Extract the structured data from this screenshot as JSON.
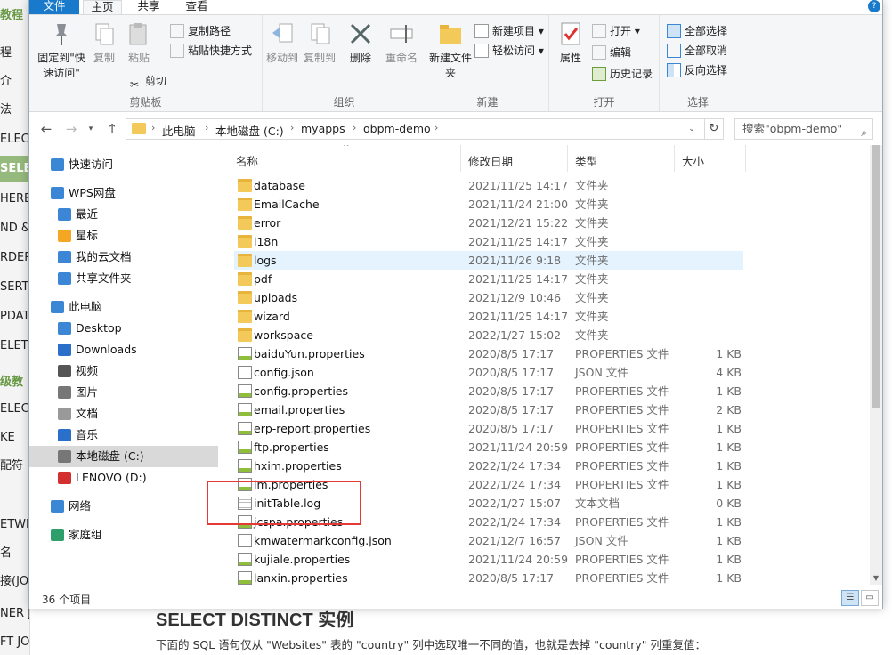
{
  "background_page": {
    "sidebar_items": [
      "教程",
      "程",
      "介",
      "法",
      "ELECT",
      "SELECT",
      "HERE",
      "ND &",
      "RDER",
      "SERT",
      "PDATE",
      "ELETE",
      "级教",
      "ELEC",
      "KE",
      "配符",
      "",
      "ETWE",
      "名",
      "接(JO",
      "NER JOIN",
      "FT JOIN"
    ],
    "heading": "SELECT DISTINCT 实例",
    "text": "下面的 SQL 语句仅从 \"Websites\" 表的 \"country\" 列中选取唯一不同的值，也就是去掉 \"country\" 列重复值："
  },
  "tabs": {
    "file": "文件",
    "home": "主页",
    "share": "共享",
    "view": "查看"
  },
  "ribbon": {
    "clipboard": {
      "pin_label": "固定到\"快速访问\"",
      "copy_label": "复制",
      "paste_label": "粘贴",
      "copy_path_label": "复制路径",
      "paste_shortcut_label": "粘贴快捷方式",
      "cut_label": "剪切",
      "group_label": "剪贴板"
    },
    "organize": {
      "move_to_label": "移动到",
      "copy_to_label": "复制到",
      "delete_label": "删除",
      "rename_label": "重命名",
      "group_label": "组织"
    },
    "new": {
      "new_folder_label": "新建文件夹",
      "new_item_label": "新建项目",
      "easy_access_label": "轻松访问",
      "group_label": "新建"
    },
    "open": {
      "properties_label": "属性",
      "open_label": "打开",
      "edit_label": "编辑",
      "history_label": "历史记录",
      "group_label": "打开"
    },
    "select": {
      "select_all_label": "全部选择",
      "select_none_label": "全部取消",
      "invert_label": "反向选择",
      "group_label": "选择"
    }
  },
  "address": {
    "crumbs": [
      "此电脑",
      "本地磁盘 (C:)",
      "myapps",
      "obpm-demo"
    ],
    "search_placeholder": "搜索\"obpm-demo\""
  },
  "nav": [
    {
      "label": "快速访问",
      "icon": "star-icon",
      "color": "#3b87d6"
    },
    {
      "label": "WPS网盘",
      "icon": "cloud-icon",
      "color": "#3b87d6"
    },
    {
      "label": "最近",
      "icon": "clock-icon",
      "color": "#3b87d6"
    },
    {
      "label": "星标",
      "icon": "star-icon",
      "color": "#f5a623"
    },
    {
      "label": "我的云文档",
      "icon": "cloud-icon",
      "color": "#3b87d6"
    },
    {
      "label": "共享文件夹",
      "icon": "share-icon",
      "color": "#3b87d6"
    },
    {
      "label": "此电脑",
      "icon": "computer-icon",
      "color": "#3b87d6"
    },
    {
      "label": "Desktop",
      "icon": "desktop-icon",
      "color": "#3b87d6"
    },
    {
      "label": "Downloads",
      "icon": "download-icon",
      "color": "#2a6fc9"
    },
    {
      "label": "视频",
      "icon": "video-icon",
      "color": "#555555"
    },
    {
      "label": "图片",
      "icon": "picture-icon",
      "color": "#777777"
    },
    {
      "label": "文档",
      "icon": "document-icon",
      "color": "#999999"
    },
    {
      "label": "音乐",
      "icon": "music-icon",
      "color": "#2a6fc9"
    },
    {
      "label": "本地磁盘 (C:)",
      "icon": "drive-icon",
      "color": "#777777"
    },
    {
      "label": "LENOVO (D:)",
      "icon": "drive-icon",
      "color": "#d32f2f"
    },
    {
      "label": "网络",
      "icon": "network-icon",
      "color": "#3b87d6"
    },
    {
      "label": "家庭组",
      "icon": "homegroup-icon",
      "color": "#2e9e6a"
    }
  ],
  "columns": {
    "name": "名称",
    "date": "修改日期",
    "type": "类型",
    "size": "大小"
  },
  "files": [
    {
      "name": "database",
      "date": "2021/11/25 14:17",
      "type": "文件夹",
      "size": "",
      "icon": "folder-icon"
    },
    {
      "name": "EmailCache",
      "date": "2021/11/24 21:00",
      "type": "文件夹",
      "size": "",
      "icon": "folder-icon"
    },
    {
      "name": "error",
      "date": "2021/12/21 15:22",
      "type": "文件夹",
      "size": "",
      "icon": "folder-icon"
    },
    {
      "name": "i18n",
      "date": "2021/11/25 14:17",
      "type": "文件夹",
      "size": "",
      "icon": "folder-icon"
    },
    {
      "name": "logs",
      "date": "2021/11/26 9:18",
      "type": "文件夹",
      "size": "",
      "icon": "folder-icon"
    },
    {
      "name": "pdf",
      "date": "2021/11/25 14:17",
      "type": "文件夹",
      "size": "",
      "icon": "folder-icon"
    },
    {
      "name": "uploads",
      "date": "2021/12/9 10:46",
      "type": "文件夹",
      "size": "",
      "icon": "folder-icon"
    },
    {
      "name": "wizard",
      "date": "2021/11/25 14:17",
      "type": "文件夹",
      "size": "",
      "icon": "folder-icon"
    },
    {
      "name": "workspace",
      "date": "2022/1/27 15:02",
      "type": "文件夹",
      "size": "",
      "icon": "folder-icon"
    },
    {
      "name": "baiduYun.properties",
      "date": "2020/8/5 17:17",
      "type": "PROPERTIES 文件",
      "size": "1 KB",
      "icon": "properties-file-icon"
    },
    {
      "name": "config.json",
      "date": "2020/8/5 17:17",
      "type": "JSON 文件",
      "size": "4 KB",
      "icon": "json-file-icon"
    },
    {
      "name": "config.properties",
      "date": "2020/8/5 17:17",
      "type": "PROPERTIES 文件",
      "size": "1 KB",
      "icon": "properties-file-icon"
    },
    {
      "name": "email.properties",
      "date": "2020/8/5 17:17",
      "type": "PROPERTIES 文件",
      "size": "2 KB",
      "icon": "properties-file-icon"
    },
    {
      "name": "erp-report.properties",
      "date": "2020/8/5 17:17",
      "type": "PROPERTIES 文件",
      "size": "1 KB",
      "icon": "properties-file-icon"
    },
    {
      "name": "ftp.properties",
      "date": "2021/11/24 20:59",
      "type": "PROPERTIES 文件",
      "size": "1 KB",
      "icon": "properties-file-icon"
    },
    {
      "name": "hxim.properties",
      "date": "2022/1/24 17:34",
      "type": "PROPERTIES 文件",
      "size": "1 KB",
      "icon": "properties-file-icon"
    },
    {
      "name": "im.properties",
      "date": "2022/1/24 17:34",
      "type": "PROPERTIES 文件",
      "size": "1 KB",
      "icon": "properties-file-icon"
    },
    {
      "name": "initTable.log",
      "date": "2022/1/27 15:07",
      "type": "文本文档",
      "size": "0 KB",
      "icon": "log-file-icon"
    },
    {
      "name": "jcspa.properties",
      "date": "2022/1/24 17:34",
      "type": "PROPERTIES 文件",
      "size": "1 KB",
      "icon": "properties-file-icon"
    },
    {
      "name": "kmwatermarkconfig.json",
      "date": "2021/12/7 16:57",
      "type": "JSON 文件",
      "size": "1 KB",
      "icon": "json-file-icon"
    },
    {
      "name": "kujiale.properties",
      "date": "2021/11/24 20:59",
      "type": "PROPERTIES 文件",
      "size": "1 KB",
      "icon": "properties-file-icon"
    },
    {
      "name": "lanxin.properties",
      "date": "2020/8/5 17:17",
      "type": "PROPERTIES 文件",
      "size": "1 KB",
      "icon": "properties-file-icon"
    }
  ],
  "status": {
    "count": "36 个项目"
  }
}
